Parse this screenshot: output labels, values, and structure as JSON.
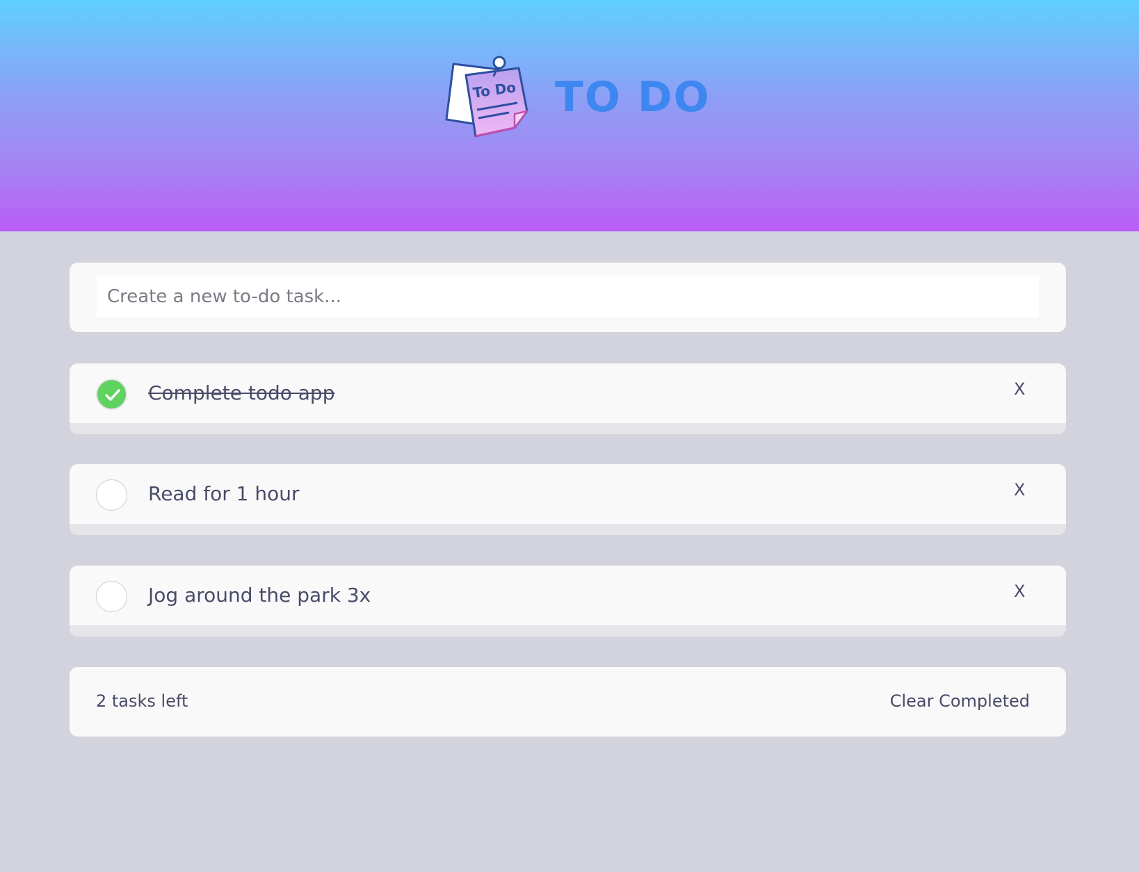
{
  "header": {
    "title": "TO DO",
    "logo_text": "To Do"
  },
  "new_task": {
    "placeholder": "Create a new to-do task...",
    "value": ""
  },
  "tasks": [
    {
      "text": "Complete todo app",
      "completed": true,
      "delete_label": "X"
    },
    {
      "text": "Read for 1 hour",
      "completed": false,
      "delete_label": "X"
    },
    {
      "text": "Jog around the park 3x",
      "completed": false,
      "delete_label": "X"
    }
  ],
  "footer": {
    "tasks_left": "2 tasks left",
    "clear_label": "Clear Completed"
  },
  "colors": {
    "accent": "#3e86f0",
    "check_done": "#5fd25f",
    "text": "#4a4b68",
    "background": "#d3d3dd",
    "gradient_top": "#5fd0fe",
    "gradient_bottom": "#bb5cf6"
  },
  "icons": {
    "logo": "sticky-note-icon",
    "check": "checkmark-icon"
  }
}
